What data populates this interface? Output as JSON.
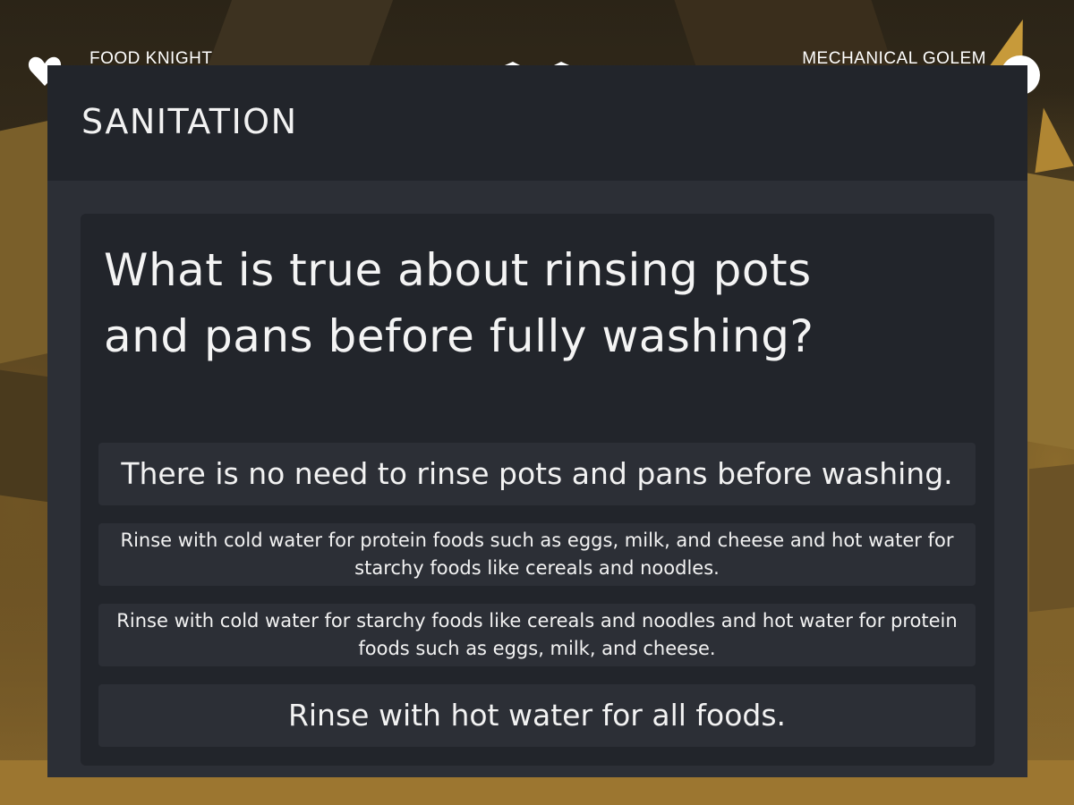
{
  "hud": {
    "player_name": "FOOD KNIGHT",
    "enemy_name": "MECHANICAL GOLEM",
    "player_icon": "heart-icon",
    "enemy_icon": "enemy-emblem-icon"
  },
  "modal": {
    "title": "SANITATION",
    "question": "What is true about rinsing pots and pans before fully washing?",
    "answers": [
      {
        "label": "There is no need to rinse pots and pans before washing."
      },
      {
        "label": "Rinse with cold water for protein foods such as eggs, milk, and cheese and hot water for starchy foods like cereals and noodles."
      },
      {
        "label": "Rinse with cold water for starchy foods like cereals and noodles and hot water for protein foods such as eggs, milk, and cheese."
      },
      {
        "label": "Rinse with hot water for all foods."
      }
    ]
  },
  "colors": {
    "modal_bg": "#2c2f36",
    "header_bg": "#22252b",
    "card_bg": "#22252b",
    "answer_bg": "#2c2f36",
    "text": "#f2f2f2"
  }
}
